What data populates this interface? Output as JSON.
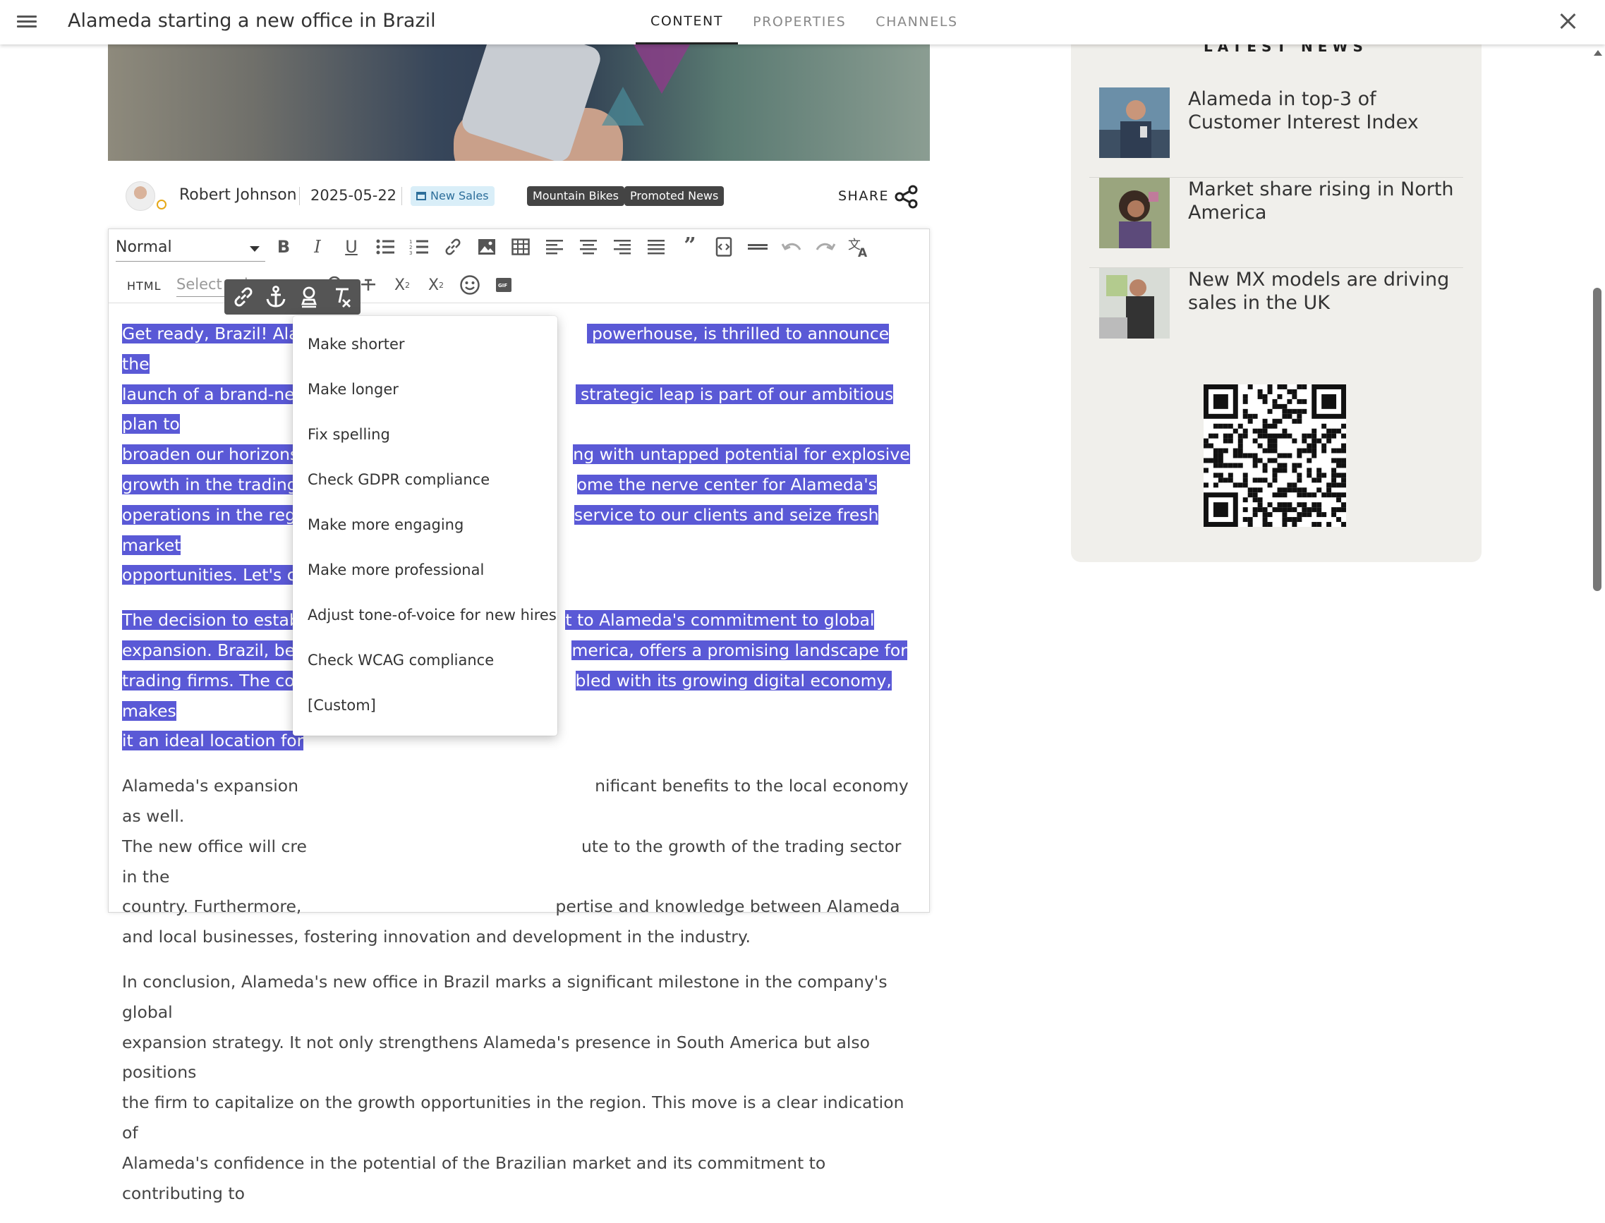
{
  "header": {
    "title": "Alameda starting a new office in Brazil",
    "tabs": [
      {
        "label": "CONTENT",
        "active": true
      },
      {
        "label": "PROPERTIES",
        "active": false
      },
      {
        "label": "CHANNELS",
        "active": false
      }
    ]
  },
  "article_meta": {
    "author": "Robert Johnson",
    "date": "2025-05-22",
    "category_tag": "New Sales",
    "tags": [
      "Mountain Bikes",
      "Promoted News"
    ],
    "share_label": "SHARE"
  },
  "toolbar": {
    "block_style": "Normal",
    "html_label": "HTML",
    "color_placeholder": "Select color"
  },
  "ai_menu": {
    "items": [
      "Make shorter",
      "Make longer",
      "Fix spelling",
      "Check GDPR compliance",
      "Make more engaging",
      "Make more professional",
      "Adjust tone-of-voice for new hires",
      "Check WCAG compliance",
      "[Custom]"
    ]
  },
  "body": {
    "p1": [
      "Get ready, Brazil! Alam",
      " powerhouse, is thrilled to announce the",
      "launch of a brand-nev",
      " strategic leap is part of our ambitious plan to",
      "broaden our horizons",
      "ng with untapped potential for explosive",
      "growth in the trading a",
      "ome the nerve center for Alameda's",
      "operations in the regio",
      "service to our clients and seize fresh market",
      "opportunities. Let's co"
    ],
    "p2": [
      "The decision to establ",
      "t to Alameda's commitment to global",
      "expansion. Brazil, bein",
      "merica, offers a promising landscape for",
      "trading firms. The cou",
      "bled with its growing digital economy, makes",
      "it an ideal location for"
    ],
    "p3": [
      "Alameda's expansion",
      "nificant benefits to the local economy as well.",
      "The new office will cre",
      "ute to the growth of the trading sector in the",
      "country. Furthermore,",
      "pertise and knowledge between Alameda",
      "and local businesses, fostering innovation and development in the industry."
    ],
    "p4": [
      "In conclusion, Alameda's new office in Brazil marks a significant milestone in the company's global",
      "expansion strategy. It not only strengthens Alameda's presence in South America but also positions",
      "the firm to capitalize on the growth opportunities in the region. This move is a clear indication of",
      "Alameda's confidence in the potential of the Brazilian market and its commitment to contributing to"
    ]
  },
  "sidebar": {
    "heading": "LATEST NEWS",
    "news": [
      {
        "title": "Alameda in top-3 of Customer Interest Index"
      },
      {
        "title": "Market share rising in North America"
      },
      {
        "title": "New MX models are driving sales in the UK"
      }
    ]
  },
  "colors": {
    "selection": "#5a59d6",
    "sidebar_bg": "#f0efeb",
    "tag_dark": "#444444",
    "tag_blue_bg": "#d9eef8"
  }
}
